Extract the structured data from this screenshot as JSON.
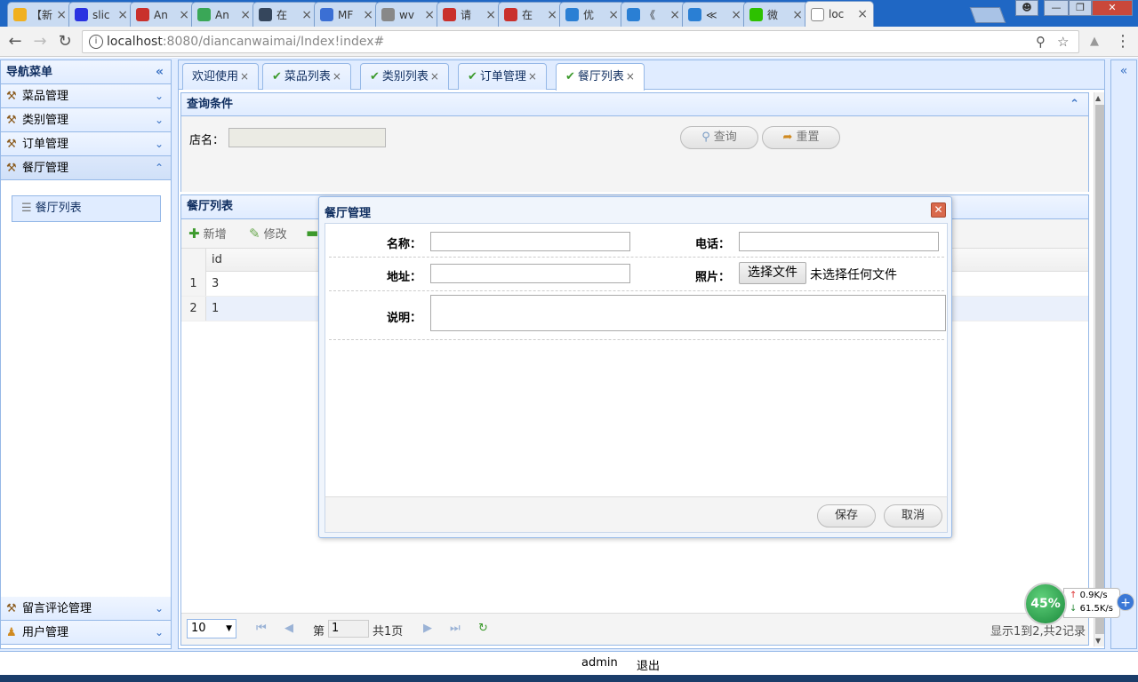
{
  "browser": {
    "tabs": [
      {
        "label": "【新",
        "favicon": "sun-icon",
        "color": "#f0b020"
      },
      {
        "label": "slic",
        "favicon": "baidu-paw-icon",
        "color": "#2932e1"
      },
      {
        "label": "An",
        "favicon": "csdn-icon",
        "color": "#c9302c"
      },
      {
        "label": "An",
        "favicon": "green-c-icon",
        "color": "#3aa757"
      },
      {
        "label": "在",
        "favicon": "tumblr-icon",
        "color": "#35465c"
      },
      {
        "label": "MF",
        "favicon": "globe-icon",
        "color": "#3b6fd4"
      },
      {
        "label": "wv",
        "favicon": "puzzle-icon",
        "color": "#888888"
      },
      {
        "label": "请",
        "favicon": "csdn-icon",
        "color": "#c9302c"
      },
      {
        "label": "在",
        "favicon": "csdn-icon",
        "color": "#c9302c"
      },
      {
        "label": "优",
        "favicon": "video-play-icon",
        "color": "#2a7fd4"
      },
      {
        "label": "《",
        "favicon": "video-play-icon",
        "color": "#2a7fd4"
      },
      {
        "label": "≪",
        "favicon": "video-play-icon",
        "color": "#2a7fd4"
      },
      {
        "label": "微",
        "favicon": "wechat-icon",
        "color": "#2dc100"
      },
      {
        "label": "loc",
        "favicon": "page-icon",
        "color": "#ffffff"
      }
    ],
    "url_host": "localhost",
    "url_rest": ":8080/diancanwaimai/Index!index#"
  },
  "sidebar": {
    "title": "导航菜单",
    "items": [
      {
        "label": "菜品管理"
      },
      {
        "label": "类别管理"
      },
      {
        "label": "订单管理"
      },
      {
        "label": "餐厅管理"
      }
    ],
    "sub_items": [
      {
        "label": "餐厅列表"
      }
    ],
    "bottom_items": [
      {
        "label": "留言评论管理"
      },
      {
        "label": "用户管理"
      }
    ]
  },
  "page_tabs": [
    {
      "label": "欢迎使用"
    },
    {
      "label": "菜品列表"
    },
    {
      "label": "类别列表"
    },
    {
      "label": "订单管理"
    },
    {
      "label": "餐厅列表"
    }
  ],
  "query": {
    "title": "查询条件",
    "shop_name_label": "店名：",
    "shop_name_value": "",
    "search_button": "查询",
    "reset_button": "重置"
  },
  "grid": {
    "title": "餐厅列表",
    "toolbar": {
      "add": "新增",
      "edit": "修改"
    },
    "columns": [
      "id"
    ],
    "rows": [
      {
        "rownum": "1",
        "id": "3"
      },
      {
        "rownum": "2",
        "id": "1"
      }
    ],
    "pager": {
      "page_size": "10",
      "page_prefix": "第",
      "page_value": "1",
      "page_total": "共1页",
      "summary": "显示1到2,共2记录"
    }
  },
  "dialog": {
    "title": "餐厅管理",
    "name_label": "名称：",
    "name_value": "",
    "phone_label": "电话：",
    "phone_value": "",
    "address_label": "地址：",
    "address_value": "",
    "photo_label": "照片：",
    "file_button": "选择文件",
    "file_status": "未选择任何文件",
    "desc_label": "说明：",
    "desc_value": "",
    "save_button": "保存",
    "cancel_button": "取消"
  },
  "statusbar": {
    "user": "admin",
    "logout": "退出"
  },
  "net_widget": {
    "percent": "45%",
    "up": "0.9K/s",
    "down": "61.5K/s"
  }
}
